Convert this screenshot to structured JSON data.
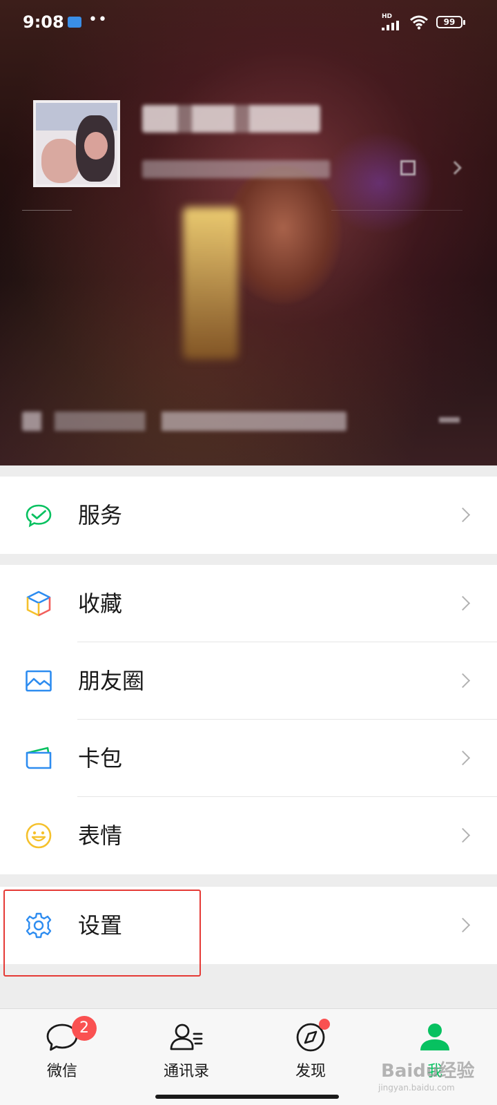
{
  "status_bar": {
    "time": "9:08",
    "dots": "••",
    "hd": "HD",
    "battery": "99"
  },
  "menu": {
    "group1": [
      {
        "label": "服务",
        "icon": "wechat-pay-icon"
      }
    ],
    "group2": [
      {
        "label": "收藏",
        "icon": "favorites-cube-icon"
      },
      {
        "label": "朋友圈",
        "icon": "moments-picture-icon"
      },
      {
        "label": "卡包",
        "icon": "card-wallet-icon"
      },
      {
        "label": "表情",
        "icon": "sticker-smiley-icon"
      }
    ],
    "group3": [
      {
        "label": "设置",
        "icon": "gear-icon"
      }
    ]
  },
  "tabbar": {
    "tabs": [
      {
        "label": "微信",
        "icon": "chat-bubble-icon",
        "badge": "2"
      },
      {
        "label": "通讯录",
        "icon": "contacts-icon"
      },
      {
        "label": "发现",
        "icon": "compass-icon",
        "dot": true
      },
      {
        "label": "我",
        "icon": "me-person-icon",
        "active": true
      }
    ]
  },
  "watermark": {
    "text": "Baidu经验",
    "sub": "jingyan.baidu.com"
  },
  "colors": {
    "accent": "#07c160",
    "badge": "#fa5151",
    "highlight_box": "#e53935"
  }
}
